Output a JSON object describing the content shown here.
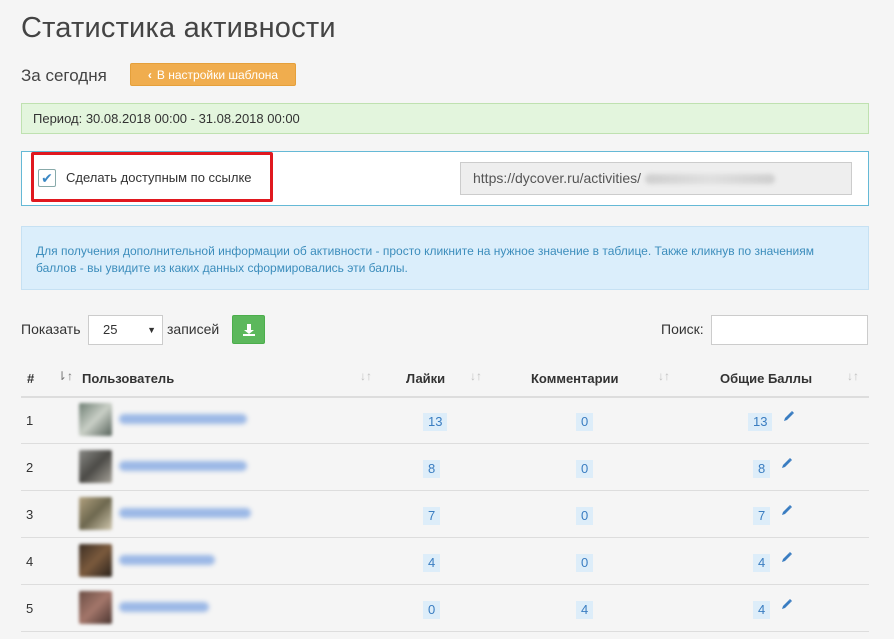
{
  "page": {
    "title": "Статистика активности",
    "subtitle": "За сегодня",
    "settings_button": "В настройки шаблона",
    "period": "Период: 30.08.2018 00:00 - 31.08.2018 00:00"
  },
  "share": {
    "checkbox_checked": true,
    "checkbox_label": "Сделать доступным по ссылке",
    "url_prefix": "https://dycover.ru/activities/"
  },
  "info_text": "Для получения дополнительной информации об активности - просто кликните на нужное значение в таблице. Также кликнув по значениям баллов - вы увидите из каких данных сформировались эти баллы.",
  "controls": {
    "show_label": "Показать",
    "page_size": "25",
    "entries_label": "записей",
    "search_label": "Поиск:"
  },
  "table": {
    "columns": [
      "#",
      "Пользователь",
      "Лайки",
      "Комментарии",
      "Общие Баллы"
    ],
    "rows": [
      {
        "num": "1",
        "likes": "13",
        "comments": "0",
        "total": "13"
      },
      {
        "num": "2",
        "likes": "8",
        "comments": "0",
        "total": "8"
      },
      {
        "num": "3",
        "likes": "7",
        "comments": "0",
        "total": "7"
      },
      {
        "num": "4",
        "likes": "4",
        "comments": "0",
        "total": "4"
      },
      {
        "num": "5",
        "likes": "0",
        "comments": "4",
        "total": "4"
      }
    ]
  },
  "colors": {
    "warning": "#f0ad4e",
    "success": "#5cb85c",
    "highlight": "#e0181f",
    "badge_text": "#3a7dc1"
  }
}
